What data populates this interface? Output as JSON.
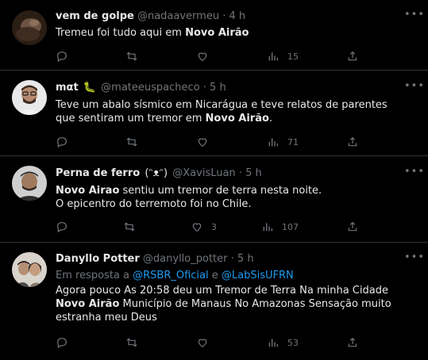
{
  "tweets": [
    {
      "name": "vem de golpe",
      "handle": "@nadaavermeu",
      "sep": "·",
      "time": "4 h",
      "text_pre": "Tremeu foi tudo aqui em ",
      "text_bold": "Novo Airão",
      "likes": "",
      "views": "15"
    },
    {
      "name": "mαt",
      "emoji": "🐛",
      "handle": "@mateeuspacheco",
      "sep": "·",
      "time": "5 h",
      "text_pre": "Teve um abalo sísmico em Nicarágua e teve relatos de parentes que sentiram um tremor em ",
      "text_bold": "Novo Airão",
      "text_post": ".",
      "likes": "",
      "views": "71"
    },
    {
      "name": "Perna de ferro",
      "face": "(ᵔᴥᵔ)",
      "handle": "@XavisLuan",
      "sep": "·",
      "time": "5 h",
      "text_bold": "Novo Airao",
      "text_post": " sentiu um tremor de terra nesta noite.",
      "text_line2": "O epicentro do terremoto foi no Chile.",
      "likes": "3",
      "views": "107"
    },
    {
      "name": "Danyllo Potter",
      "handle": "@danyllo_potter",
      "sep": "·",
      "time": "5 h",
      "reply_prefix": "Em resposta a ",
      "reply_user1": "@RSBR_Oficial",
      "reply_and": " e ",
      "reply_user2": "@LabSisUFRN",
      "text_pre": "Agora pouco As 20:58 deu um Tremor de Terra Na minha Cidade ",
      "text_bold": "Novo Airão",
      "text_post": " Município de Manaus No Amazonas Sensação muito estranha meu Deus",
      "likes": "",
      "views": "53"
    }
  ],
  "icons": {
    "reply": "reply-icon",
    "retweet": "retweet-icon",
    "like": "heart-icon",
    "views": "views-icon",
    "share": "share-icon",
    "more": "more-icon"
  },
  "colors": {
    "background": "#000000",
    "text": "#e7e9ea",
    "muted": "#71767b",
    "link": "#1d9bf0",
    "divider": "#2f3336"
  }
}
